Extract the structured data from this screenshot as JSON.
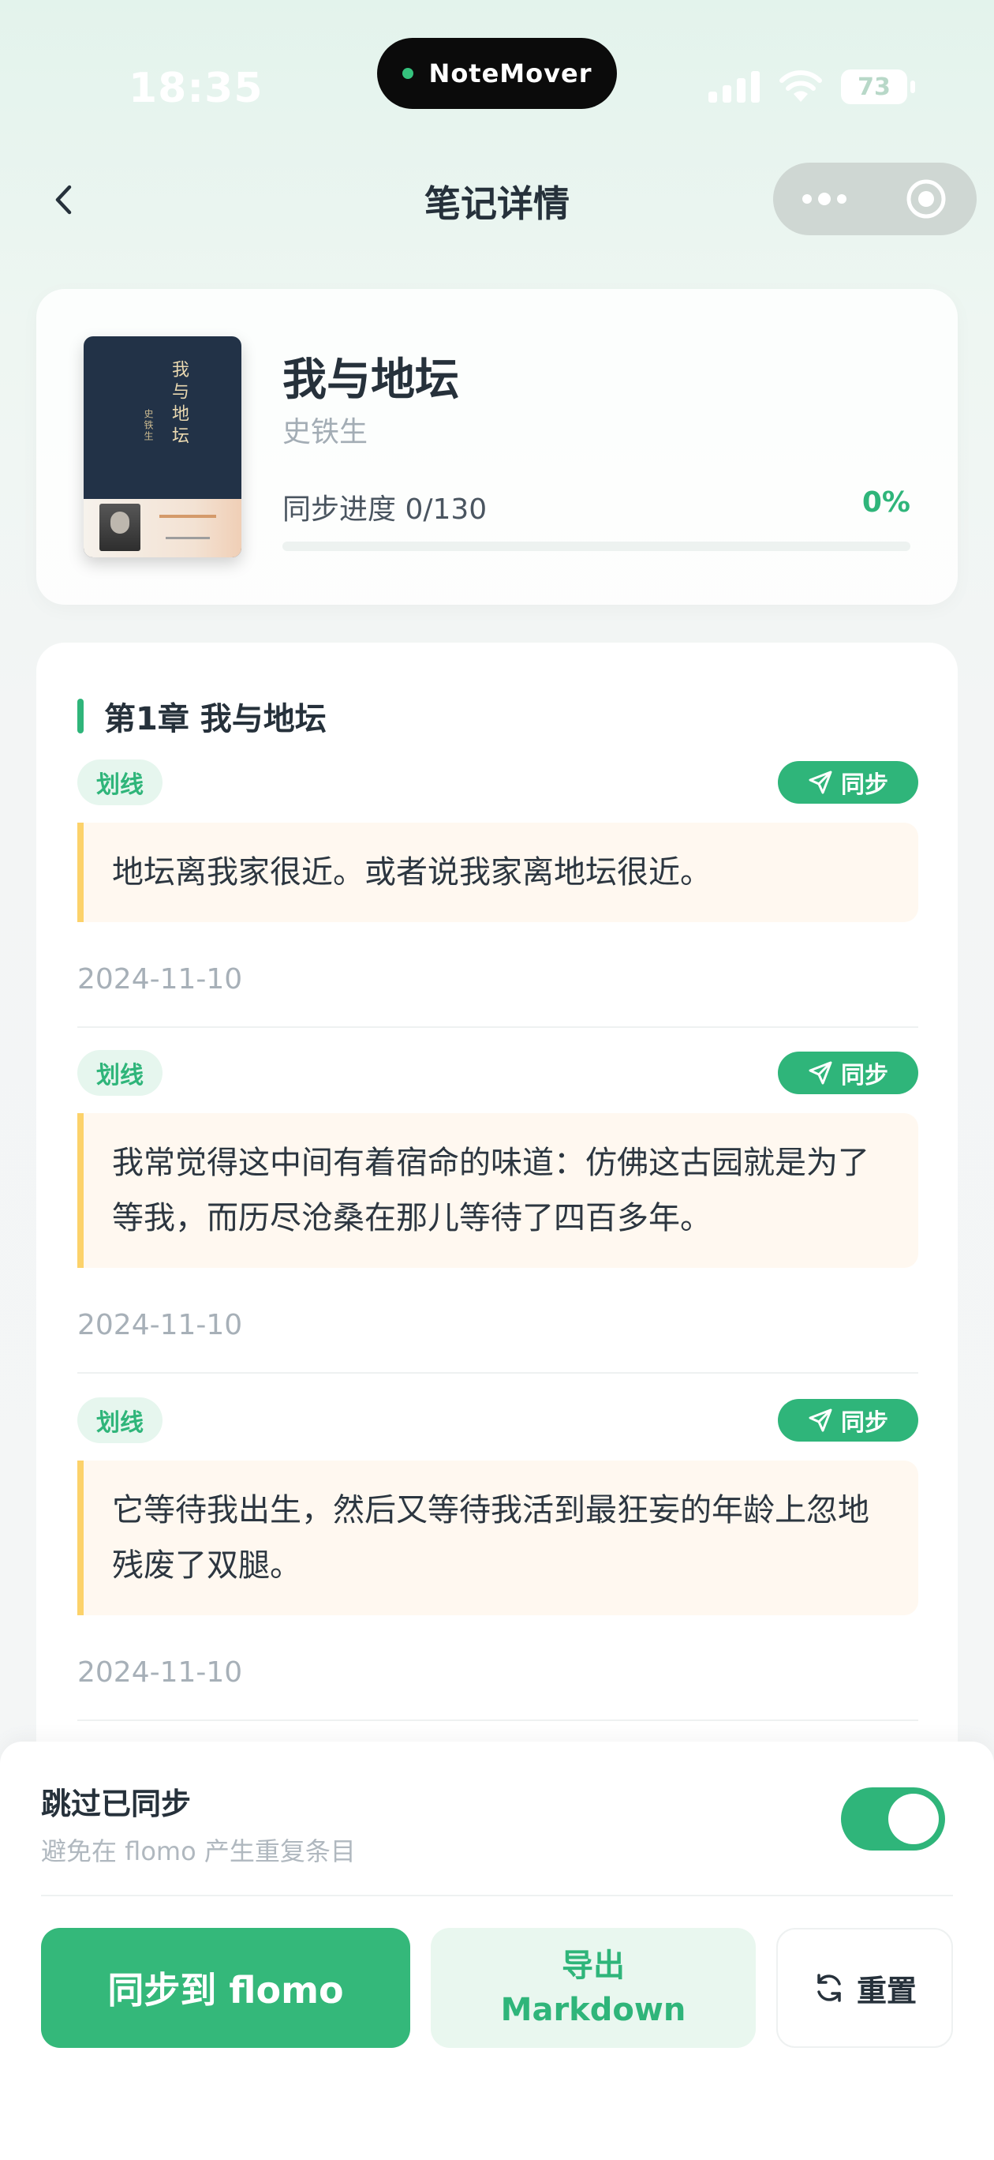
{
  "status_bar": {
    "time": "18:35",
    "island_label": "NoteMover",
    "battery": "73"
  },
  "nav": {
    "title": "笔记详情"
  },
  "book": {
    "title": "我与地坛",
    "author": "史铁生",
    "progress_label": "同步进度 0/130",
    "progress_percent": "0%",
    "progress_fraction": 0
  },
  "chapter": {
    "title": "第1章 我与地坛"
  },
  "notes": [
    {
      "tag": "划线",
      "sync_label": "同步",
      "text": "地坛离我家很近。或者说我家离地坛很近。",
      "date": "2024-11-10"
    },
    {
      "tag": "划线",
      "sync_label": "同步",
      "text": "我常觉得这中间有着宿命的味道：仿佛这古园就是为了等我，而历尽沧桑在那儿等待了四百多年。",
      "date": "2024-11-10"
    },
    {
      "tag": "划线",
      "sync_label": "同步",
      "text": "它等待我出生，然后又等待我活到最狂妄的年龄上忽地残废了双腿。",
      "date": "2024-11-10"
    }
  ],
  "bottom": {
    "skip_title": "跳过已同步",
    "skip_subtitle": "避免在 flomo 产生重复条目",
    "skip_enabled": true,
    "sync_button": "同步到 flomo",
    "export_line1": "导出",
    "export_line2": "Markdown",
    "reset_button": "重置"
  },
  "colors": {
    "accent": "#2fb57a",
    "quote_border": "#fcd26a",
    "quote_bg": "#fff8f0"
  }
}
